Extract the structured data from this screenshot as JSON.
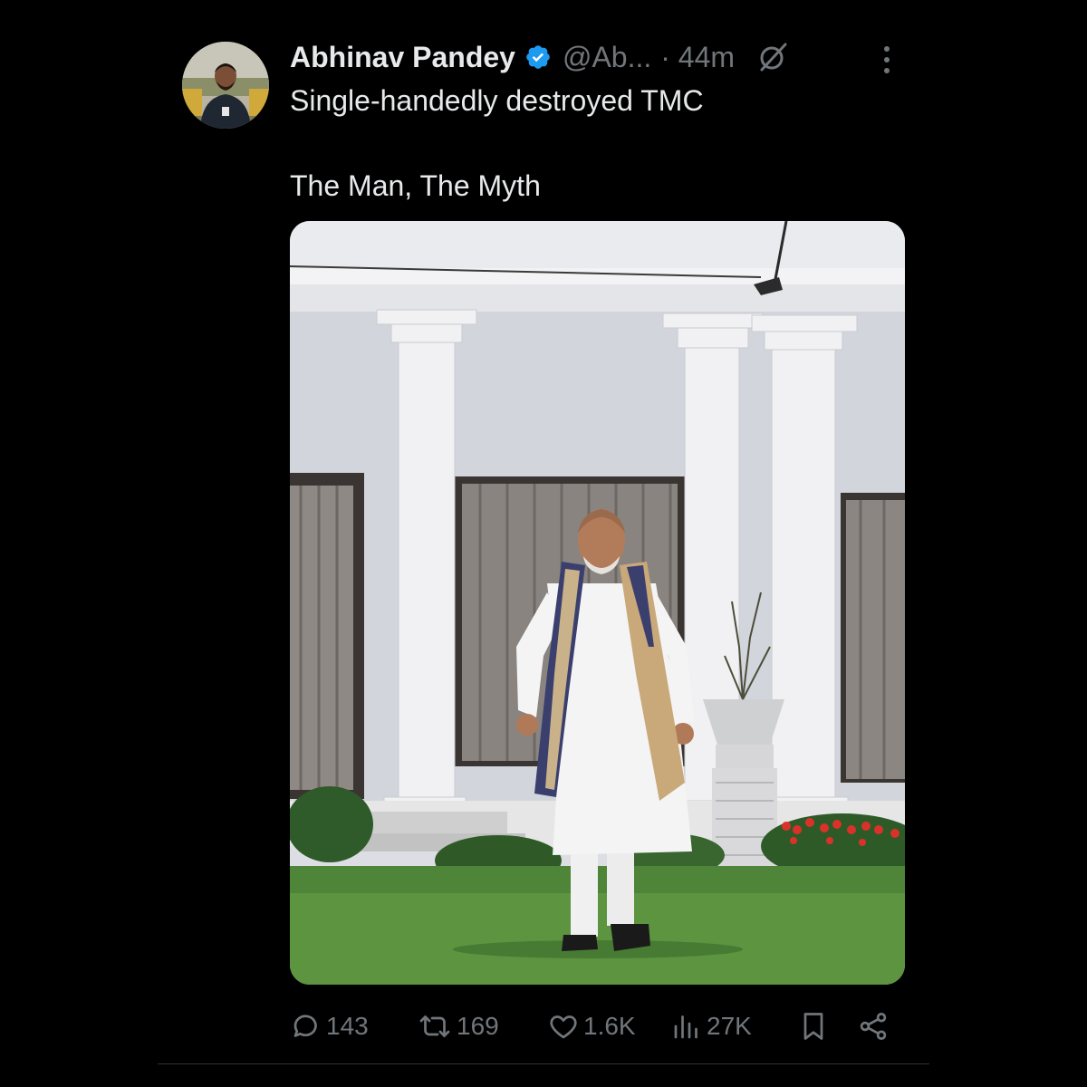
{
  "tweet": {
    "author": {
      "name": "Abhinav Pandey",
      "handle": "@Ab...",
      "verified": true,
      "avatar_icon": "avatar-photo"
    },
    "time": "· 44m",
    "text_lines": [
      "Single-handedly destroyed TMC",
      "The Man, The Myth"
    ],
    "media_icon": "photo",
    "actions": {
      "replies": "143",
      "reposts": "169",
      "likes": "1.6K",
      "views": "27K"
    }
  },
  "colors": {
    "background": "#000000",
    "text_primary": "#e7e9ea",
    "text_secondary": "#71767b",
    "verified_blue": "#1d9bf0",
    "divider": "#2f3336"
  }
}
